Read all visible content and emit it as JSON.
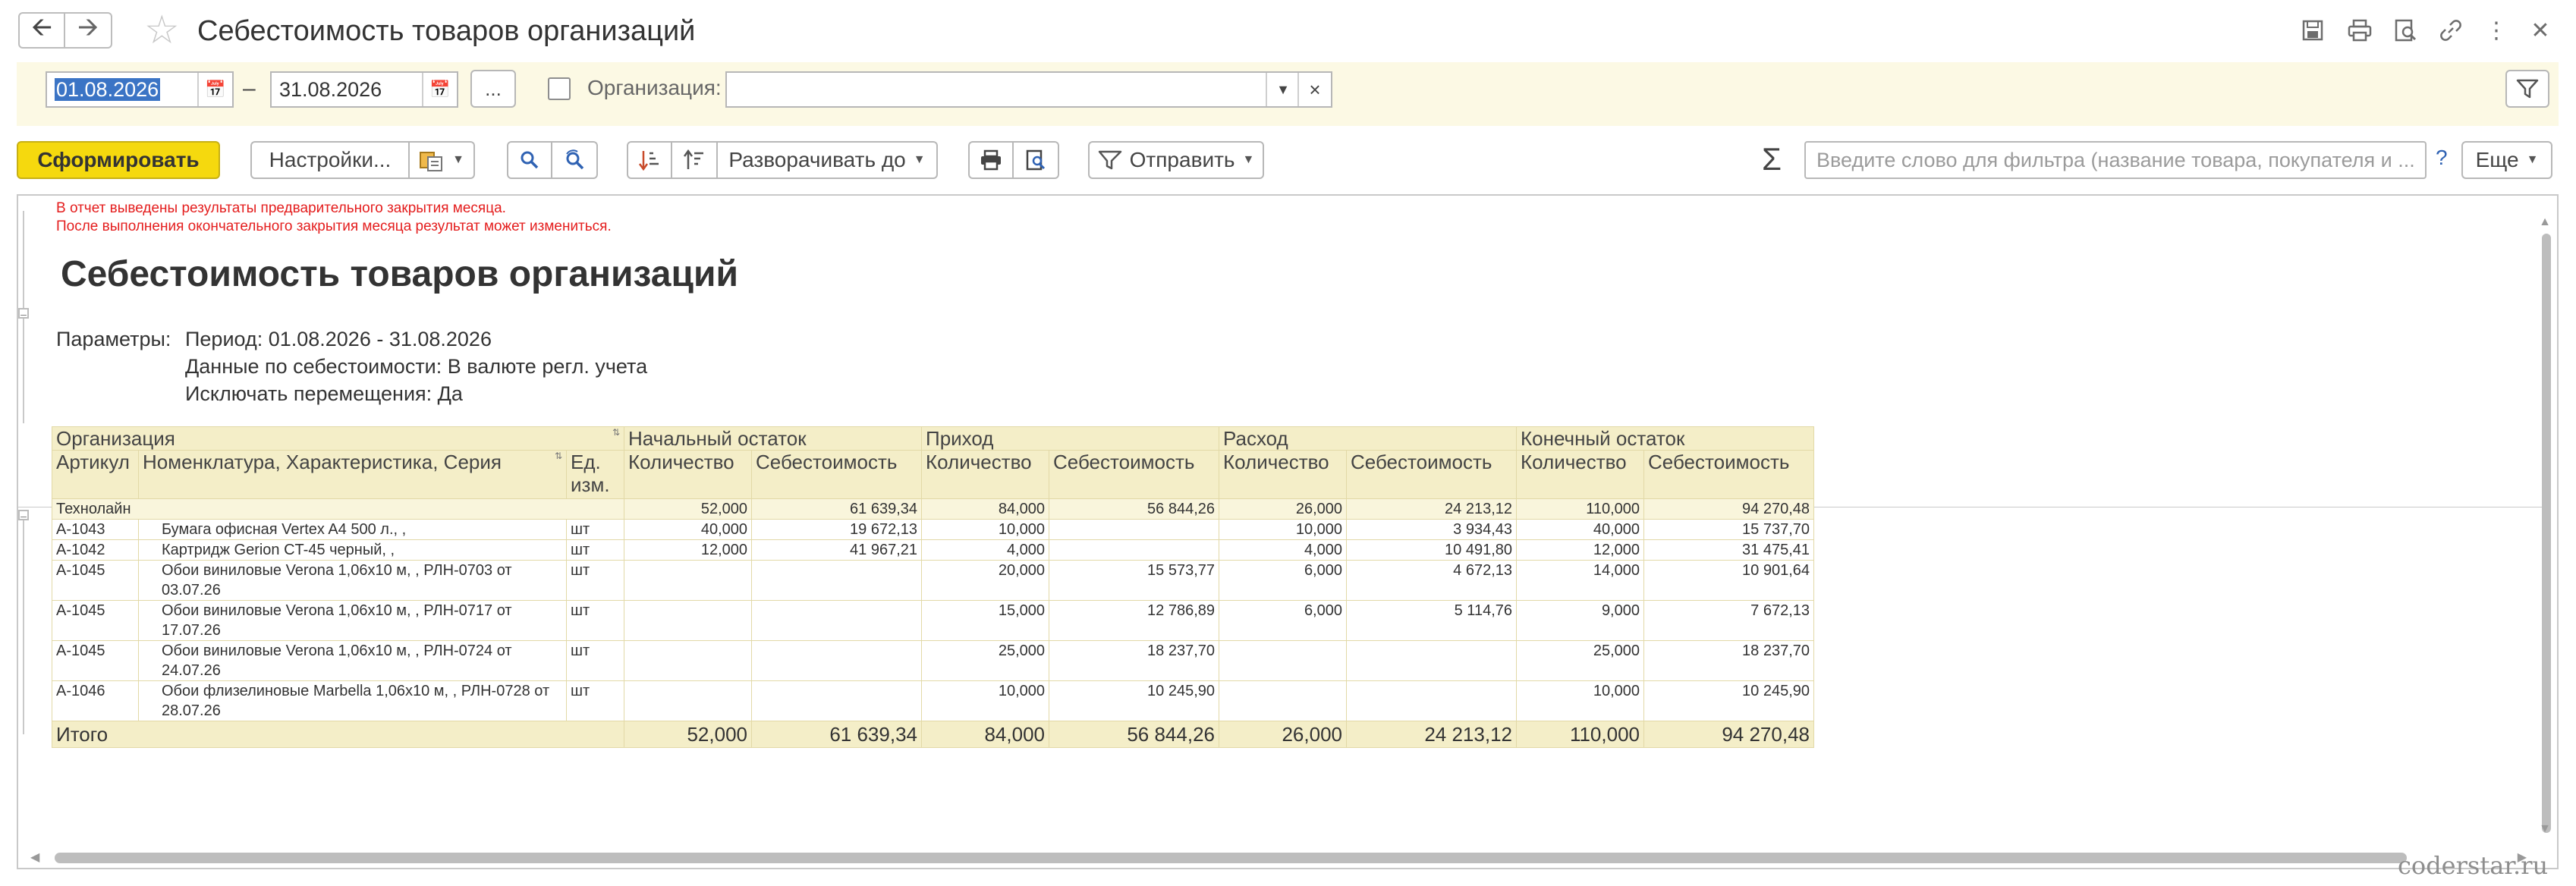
{
  "window": {
    "title": "Себестоимость товаров организаций",
    "icons": [
      "save-icon",
      "print-icon",
      "preview-icon",
      "link-icon",
      "more-vertical-icon",
      "close-icon"
    ]
  },
  "filter": {
    "date_from": "01.08.2026",
    "date_to": "31.08.2026",
    "dash": "–",
    "period_button": "...",
    "org_label": "Организация:",
    "org_value": "",
    "org_checked": false
  },
  "toolbar": {
    "generate": "Сформировать",
    "settings": "Настройки...",
    "expand_to": "Разворачивать до",
    "send": "Отправить",
    "search_placeholder": "Введите слово для фильтра (название товара, покупателя и ...",
    "help": "?",
    "more": "Еще"
  },
  "report": {
    "warning_1": "В отчет выведены результаты предварительного закрытия месяца.",
    "warning_2": "После выполнения окончательного закрытия месяца результат может измениться.",
    "title": "Себестоимость товаров организаций",
    "params_label": "Параметры:",
    "params": [
      "Период: 01.08.2026 - 31.08.2026",
      "Данные по себестоимости: В валюте регл. учета",
      "Исключать перемещения: Да"
    ],
    "headers": {
      "org": "Организация",
      "article": "Артикул",
      "nomenclature": "Номенклатура, Характеристика, Серия",
      "unit": "Ед. изм.",
      "opening": "Начальный остаток",
      "income": "Приход",
      "expense": "Расход",
      "closing": "Конечный остаток",
      "qty": "Количество",
      "cost": "Себестоимость"
    },
    "group": {
      "name": "Технолайн",
      "values": [
        "52,000",
        "61 639,34",
        "84,000",
        "56 844,26",
        "26,000",
        "24 213,12",
        "110,000",
        "94 270,48"
      ]
    },
    "rows": [
      {
        "article": "А-1043",
        "name": "Бумага офисная Vertex A4 500 л., ,",
        "unit": "шт",
        "values": [
          "40,000",
          "19 672,13",
          "10,000",
          "",
          "10,000",
          "3 934,43",
          "40,000",
          "15 737,70"
        ]
      },
      {
        "article": "А-1042",
        "name": "Картридж Gerion CT-45 черный, ,",
        "unit": "шт",
        "values": [
          "12,000",
          "41 967,21",
          "4,000",
          "",
          "4,000",
          "10 491,80",
          "12,000",
          "31 475,41"
        ]
      },
      {
        "article": "А-1045",
        "name": "Обои виниловые Verona 1,06х10 м, , РЛН-0703 от 03.07.26",
        "unit": "шт",
        "values": [
          "",
          "",
          "20,000",
          "15 573,77",
          "6,000",
          "4 672,13",
          "14,000",
          "10 901,64"
        ]
      },
      {
        "article": "А-1045",
        "name": "Обои виниловые Verona 1,06х10 м, , РЛН-0717 от 17.07.26",
        "unit": "шт",
        "values": [
          "",
          "",
          "15,000",
          "12 786,89",
          "6,000",
          "5 114,76",
          "9,000",
          "7 672,13"
        ]
      },
      {
        "article": "А-1045",
        "name": "Обои виниловые Verona 1,06х10 м, , РЛН-0724 от 24.07.26",
        "unit": "шт",
        "values": [
          "",
          "",
          "25,000",
          "18 237,70",
          "",
          "",
          "25,000",
          "18 237,70"
        ]
      },
      {
        "article": "А-1046",
        "name": "Обои флизелиновые Marbella 1,06х10 м, , РЛН-0728 от 28.07.26",
        "unit": "шт",
        "values": [
          "",
          "",
          "10,000",
          "10 245,90",
          "",
          "",
          "10,000",
          "10 245,90"
        ]
      }
    ],
    "total": {
      "label": "Итого",
      "values": [
        "52,000",
        "61 639,34",
        "84,000",
        "56 844,26",
        "26,000",
        "24 213,12",
        "110,000",
        "94 270,48"
      ]
    }
  },
  "watermark": "coderstar.ru"
}
